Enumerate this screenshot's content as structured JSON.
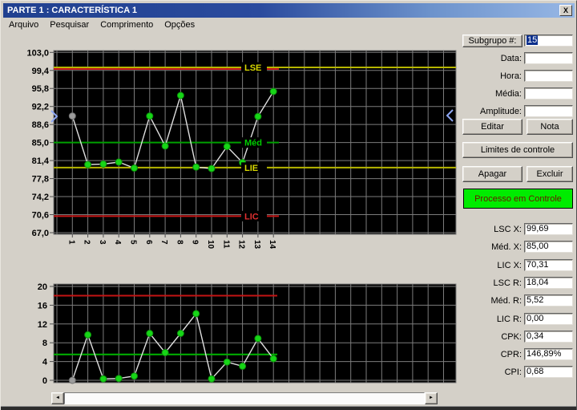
{
  "window": {
    "title": "PARTE 1 : CARACTERÍSTICA 1",
    "close_icon": "X"
  },
  "menu": {
    "items": [
      "Arquivo",
      "Pesquisar",
      "Comprimento",
      "Opções"
    ]
  },
  "panel": {
    "subgroup_button": "Subgrupo #:",
    "subgroup_value": "15",
    "fields": [
      {
        "label": "Data:",
        "value": ""
      },
      {
        "label": "Hora:",
        "value": ""
      },
      {
        "label": "Média:",
        "value": ""
      },
      {
        "label": "Amplitude:",
        "value": ""
      }
    ],
    "buttons": {
      "edit": "Editar",
      "note": "Nota",
      "limits": "Limites de controle",
      "clear": "Apagar",
      "delete": "Excluir"
    },
    "status": {
      "text": "Processo em Controle",
      "bg_color": "#00ec00",
      "text_color": "#6b1400"
    },
    "stats": [
      {
        "label": "LSC X:",
        "value": "99,69"
      },
      {
        "label": "Méd. X:",
        "value": "85,00"
      },
      {
        "label": "LIC X:",
        "value": "70,31"
      },
      {
        "label": "LSC R:",
        "value": "18,04"
      },
      {
        "label": "Méd. R:",
        "value": "5,52"
      },
      {
        "label": "LIC R:",
        "value": "0,00"
      },
      {
        "label": "CPK:",
        "value": "0,34"
      },
      {
        "label": "CPR:",
        "value": "146,89%"
      },
      {
        "label": "CPI:",
        "value": "0,68"
      }
    ]
  },
  "chart_data": [
    {
      "type": "line",
      "name": "xbar-chart",
      "title": "",
      "xlabel": "",
      "ylabel": "",
      "categories": [
        "1",
        "2",
        "3",
        "4",
        "5",
        "6",
        "7",
        "8",
        "9",
        "10",
        "11",
        "12",
        "13",
        "14"
      ],
      "values": [
        90.3,
        80.6,
        80.7,
        81.1,
        79.9,
        90.3,
        84.3,
        94.4,
        80.1,
        79.8,
        84.2,
        81.0,
        90.2,
        95.2
      ],
      "ylim": [
        67.0,
        103.0
      ],
      "ytick_labels": [
        "103,0",
        "99,4",
        "95,8",
        "92,2",
        "88,6",
        "85,0",
        "81,4",
        "77,8",
        "74,2",
        "70,6",
        "67,0"
      ],
      "grid": true,
      "bg_color": "#000000",
      "grid_color": "#7c7c7c",
      "line_color": "#dedede",
      "point_color": "#17d617",
      "point_edge": "#0b8f0b",
      "first_point_color": "#9c9c9c",
      "first_point_edge": "#6f6f6f",
      "ref_lines": [
        {
          "label": "LSE",
          "value": 100.0,
          "color": "#b6b600",
          "label_color": "#d8d800",
          "full_width": true
        },
        {
          "label": "",
          "value": 99.69,
          "color": "#c41414",
          "label_color": "",
          "full_width": false
        },
        {
          "label": "Méd",
          "value": 85.0,
          "color": "#00a100",
          "label_color": "#00cc00",
          "full_width": false
        },
        {
          "label": "LIE",
          "value": 80.0,
          "color": "#b6b600",
          "label_color": "#d8d800",
          "full_width": true
        },
        {
          "label": "LIC",
          "value": 70.31,
          "color": "#c41414",
          "label_color": "#e03030",
          "full_width": false
        }
      ]
    },
    {
      "type": "line",
      "name": "range-chart",
      "title": "",
      "xlabel": "",
      "ylabel": "",
      "categories": [
        "1",
        "2",
        "3",
        "4",
        "5",
        "6",
        "7",
        "8",
        "9",
        "10",
        "11",
        "12",
        "13",
        "14"
      ],
      "values": [
        0.0,
        9.7,
        0.3,
        0.4,
        0.9,
        10.0,
        5.9,
        10.0,
        14.2,
        0.3,
        3.9,
        3.0,
        8.9,
        4.6
      ],
      "ylim": [
        0,
        20
      ],
      "ytick_labels": [
        "20",
        "16",
        "12",
        "8",
        "4",
        "0"
      ],
      "grid": true,
      "bg_color": "#000000",
      "grid_color": "#7c7c7c",
      "line_color": "#dedede",
      "point_color": "#17d617",
      "point_edge": "#0b8f0b",
      "first_point_color": "#9c9c9c",
      "first_point_edge": "#6f6f6f",
      "ref_lines": [
        {
          "label": "",
          "value": 18.04,
          "color": "#c41414",
          "label_color": "",
          "full_width": false
        },
        {
          "label": "",
          "value": 5.52,
          "color": "#00b400",
          "label_color": "",
          "full_width": false
        }
      ]
    }
  ],
  "scrollbar": {
    "left_arrow": "◄",
    "right_arrow": "►"
  }
}
